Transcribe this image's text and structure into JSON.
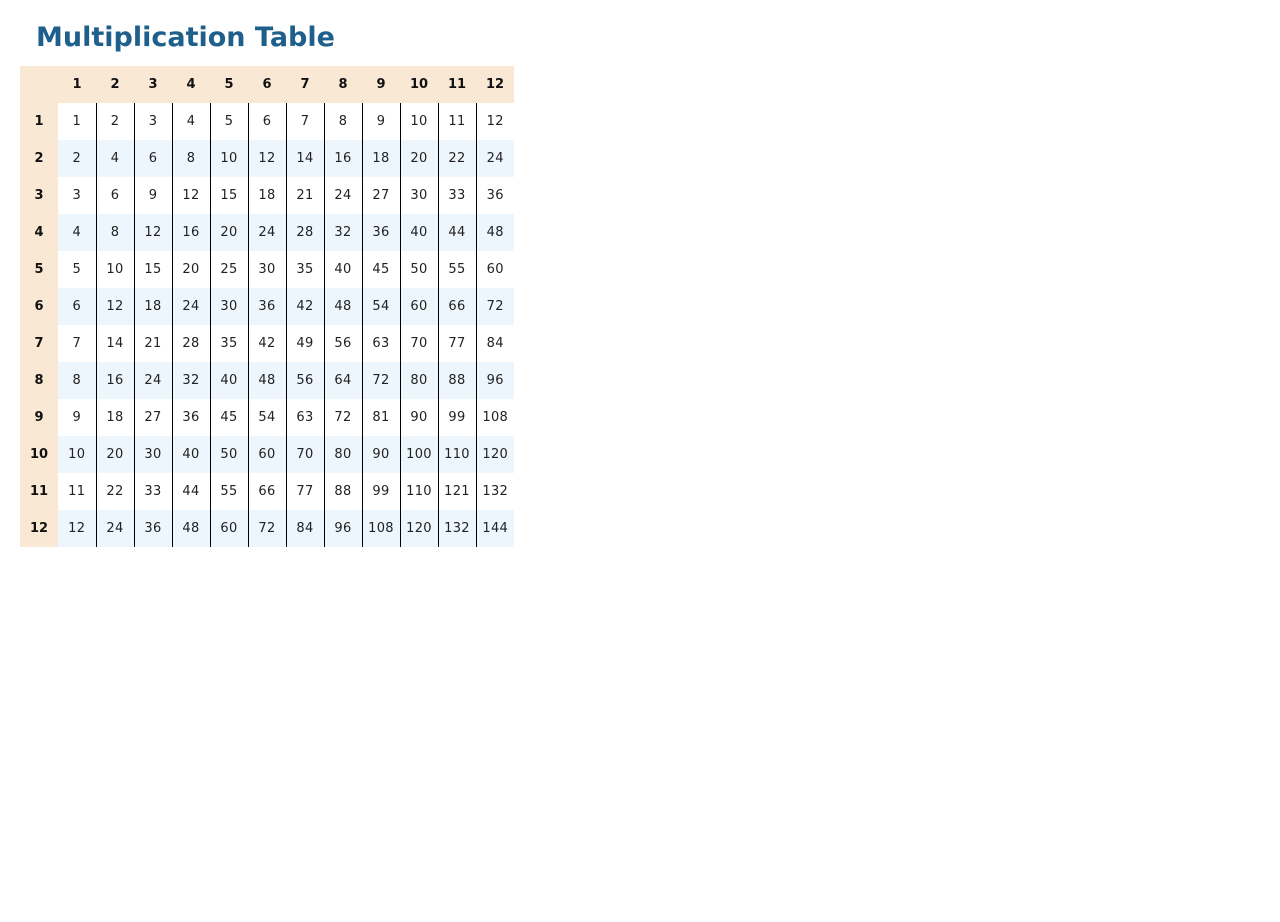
{
  "page": {
    "title": "Multiplication Table"
  },
  "colors": {
    "title": "#1f5f8b",
    "header_background": "#f9e8d4",
    "even_row_background": "#eef6fd",
    "cell_divider": "#000000"
  },
  "table": {
    "corner": "",
    "column_headers": [
      "1",
      "2",
      "3",
      "4",
      "5",
      "6",
      "7",
      "8",
      "9",
      "10",
      "11",
      "12"
    ],
    "rows": [
      {
        "header": "1",
        "cells": [
          "1",
          "2",
          "3",
          "4",
          "5",
          "6",
          "7",
          "8",
          "9",
          "10",
          "11",
          "12"
        ]
      },
      {
        "header": "2",
        "cells": [
          "2",
          "4",
          "6",
          "8",
          "10",
          "12",
          "14",
          "16",
          "18",
          "20",
          "22",
          "24"
        ]
      },
      {
        "header": "3",
        "cells": [
          "3",
          "6",
          "9",
          "12",
          "15",
          "18",
          "21",
          "24",
          "27",
          "30",
          "33",
          "36"
        ]
      },
      {
        "header": "4",
        "cells": [
          "4",
          "8",
          "12",
          "16",
          "20",
          "24",
          "28",
          "32",
          "36",
          "40",
          "44",
          "48"
        ]
      },
      {
        "header": "5",
        "cells": [
          "5",
          "10",
          "15",
          "20",
          "25",
          "30",
          "35",
          "40",
          "45",
          "50",
          "55",
          "60"
        ]
      },
      {
        "header": "6",
        "cells": [
          "6",
          "12",
          "18",
          "24",
          "30",
          "36",
          "42",
          "48",
          "54",
          "60",
          "66",
          "72"
        ]
      },
      {
        "header": "7",
        "cells": [
          "7",
          "14",
          "21",
          "28",
          "35",
          "42",
          "49",
          "56",
          "63",
          "70",
          "77",
          "84"
        ]
      },
      {
        "header": "8",
        "cells": [
          "8",
          "16",
          "24",
          "32",
          "40",
          "48",
          "56",
          "64",
          "72",
          "80",
          "88",
          "96"
        ]
      },
      {
        "header": "9",
        "cells": [
          "9",
          "18",
          "27",
          "36",
          "45",
          "54",
          "63",
          "72",
          "81",
          "90",
          "99",
          "108"
        ]
      },
      {
        "header": "10",
        "cells": [
          "10",
          "20",
          "30",
          "40",
          "50",
          "60",
          "70",
          "80",
          "90",
          "100",
          "110",
          "120"
        ]
      },
      {
        "header": "11",
        "cells": [
          "11",
          "22",
          "33",
          "44",
          "55",
          "66",
          "77",
          "88",
          "99",
          "110",
          "121",
          "132"
        ]
      },
      {
        "header": "12",
        "cells": [
          "12",
          "24",
          "36",
          "48",
          "60",
          "72",
          "84",
          "96",
          "108",
          "120",
          "132",
          "144"
        ]
      }
    ]
  }
}
